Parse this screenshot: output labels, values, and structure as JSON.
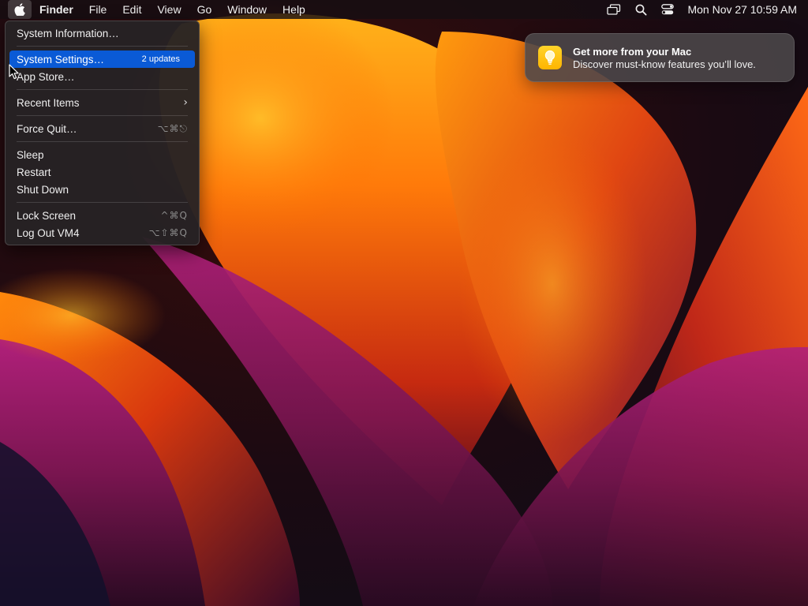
{
  "menubar": {
    "apple_icon": "apple-logo-icon",
    "app_name": "Finder",
    "menus": [
      "File",
      "Edit",
      "View",
      "Go",
      "Window",
      "Help"
    ],
    "status_icons": [
      "screen-mirroring-icon",
      "spotlight-search-icon",
      "control-center-icon"
    ],
    "clock": "Mon Nov 27  10:59 AM"
  },
  "apple_menu": {
    "system_information": "System Information…",
    "system_settings": "System Settings…",
    "system_settings_badge": "2 updates",
    "app_store": "App Store…",
    "recent_items": "Recent Items",
    "force_quit": "Force Quit…",
    "force_quit_shortcut": "⌥⌘⎋",
    "sleep": "Sleep",
    "restart": "Restart",
    "shut_down": "Shut Down",
    "lock_screen": "Lock Screen",
    "lock_screen_shortcut": "^⌘Q",
    "log_out": "Log Out VM4",
    "log_out_shortcut": "⌥⇧⌘Q",
    "highlighted_item": "System Settings…"
  },
  "notification": {
    "icon": "lightbulb-tips-icon",
    "title": "Get more from your Mac",
    "body": "Discover must-know features you’ll love."
  },
  "colors": {
    "menu_highlight": "#0a5ad6",
    "notification_icon": "#ffc21a"
  }
}
